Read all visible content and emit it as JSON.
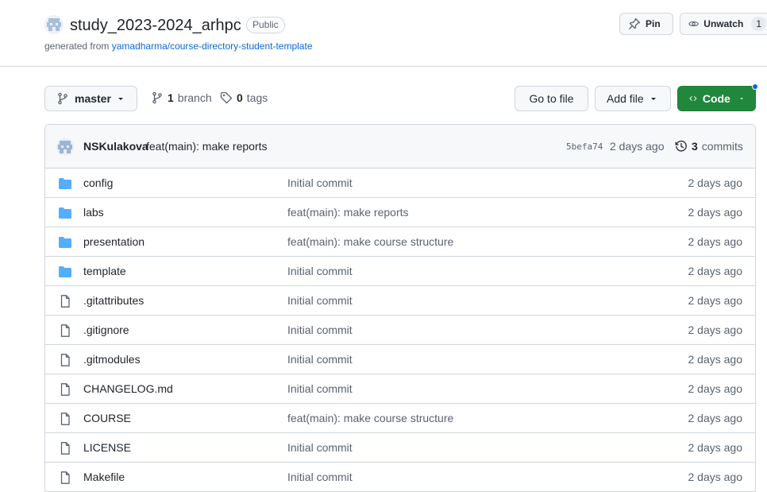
{
  "repo": {
    "name": "study_2023-2024_arhpc",
    "visibility": "Public",
    "generated_prefix": "generated from ",
    "template_link": "yamadharma/course-directory-student-template"
  },
  "header_actions": {
    "pin_label": "Pin",
    "unwatch_label": "Unwatch",
    "watch_count": "1"
  },
  "toolbar": {
    "branch": "master",
    "branch_count": "1",
    "branch_word": "branch",
    "tag_count": "0",
    "tag_word": "tags",
    "go_to_file": "Go to file",
    "add_file": "Add file",
    "code": "Code"
  },
  "latest_commit": {
    "author": "NSKulakova",
    "message": "feat(main): make reports",
    "sha": "5befa74",
    "time": "2 days ago",
    "commit_count": "3",
    "commit_word": "commits"
  },
  "files": [
    {
      "type": "folder",
      "name": "config",
      "commit": "Initial commit",
      "time": "2 days ago"
    },
    {
      "type": "folder",
      "name": "labs",
      "commit": "feat(main): make reports",
      "time": "2 days ago"
    },
    {
      "type": "folder",
      "name": "presentation",
      "commit": "feat(main): make course structure",
      "time": "2 days ago"
    },
    {
      "type": "folder",
      "name": "template",
      "commit": "Initial commit",
      "time": "2 days ago"
    },
    {
      "type": "file",
      "name": ".gitattributes",
      "commit": "Initial commit",
      "time": "2 days ago"
    },
    {
      "type": "file",
      "name": ".gitignore",
      "commit": "Initial commit",
      "time": "2 days ago"
    },
    {
      "type": "file",
      "name": ".gitmodules",
      "commit": "Initial commit",
      "time": "2 days ago"
    },
    {
      "type": "file",
      "name": "CHANGELOG.md",
      "commit": "Initial commit",
      "time": "2 days ago"
    },
    {
      "type": "file",
      "name": "COURSE",
      "commit": "feat(main): make course structure",
      "time": "2 days ago"
    },
    {
      "type": "file",
      "name": "LICENSE",
      "commit": "Initial commit",
      "time": "2 days ago"
    },
    {
      "type": "file",
      "name": "Makefile",
      "commit": "Initial commit",
      "time": "2 days ago"
    }
  ],
  "colors": {
    "folder": "#54aeff",
    "file_icon": "#59636e",
    "link": "#0969da",
    "code_button": "#1f883d",
    "notification_dot": "#0969da"
  }
}
